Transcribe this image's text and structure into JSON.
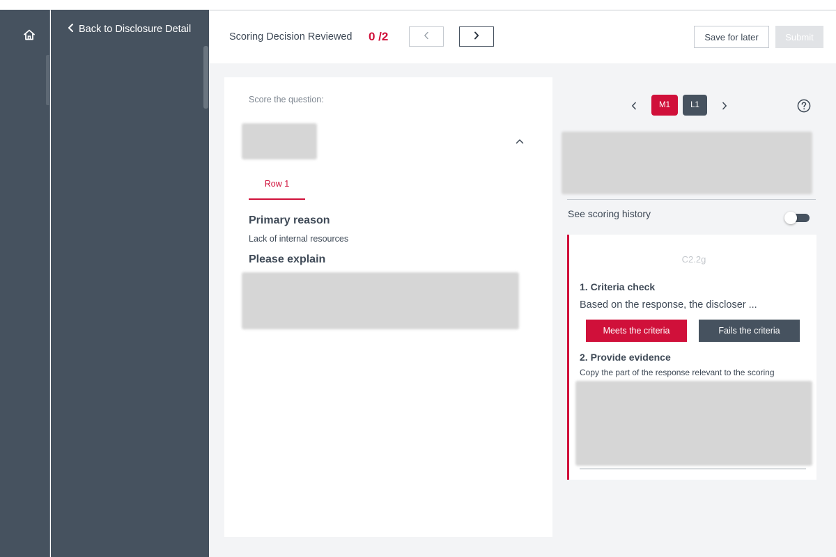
{
  "sidebar": {
    "back_label": "Back to Disclosure Detail"
  },
  "header": {
    "title": "Scoring Decision Reviewed",
    "count": "0 /2",
    "save_label": "Save for later",
    "submit_label": "Submit"
  },
  "question": {
    "score_label": "Score the question:",
    "tab_label": "Row 1",
    "primary_reason_heading": "Primary reason",
    "primary_reason_value": "Lack of internal resources",
    "explain_heading": "Please explain"
  },
  "reviewer": {
    "tabs": [
      "M1",
      "L1"
    ],
    "active_tab": "M1",
    "scoring_history_label": "See scoring history",
    "scoring_history_on": false
  },
  "criteria": {
    "code": "C2.2g",
    "check_heading": "1. Criteria check",
    "check_text": "Based on the response, the discloser ...",
    "meets_label": "Meets the criteria",
    "fails_label": "Fails the criteria",
    "evidence_heading": "2. Provide evidence",
    "evidence_text": "Copy the part of the response relevant to the scoring"
  },
  "colors": {
    "accent": "#d0103a",
    "sidebar": "#46525f",
    "background": "#f3f4f6"
  },
  "icons": {
    "home": "home-icon",
    "back": "chevron-left-icon",
    "prev": "chevron-left-icon",
    "next": "chevron-right-icon",
    "collapse": "chevron-up-icon",
    "help": "question-circle-icon"
  }
}
